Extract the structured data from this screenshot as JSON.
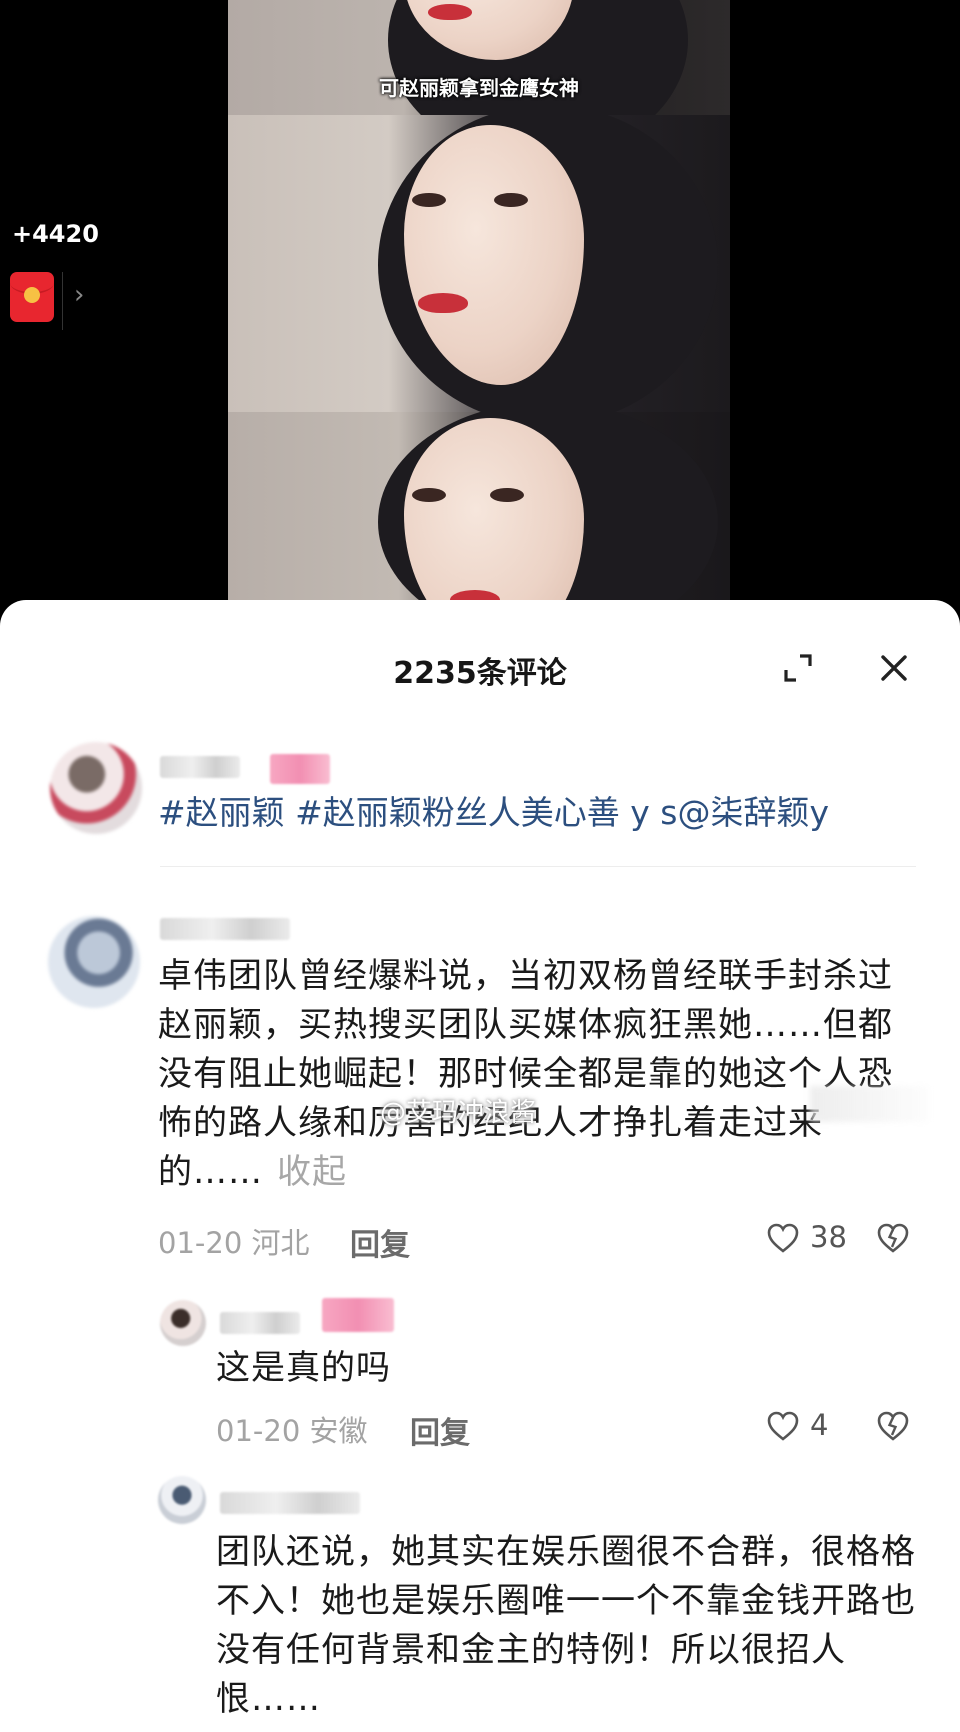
{
  "video": {
    "subtitle": "可赵丽颖拿到金鹰女神"
  },
  "overlay": {
    "counter": "+4420",
    "arrow": "›"
  },
  "sheet": {
    "title": "2235条评论",
    "comments": [
      {
        "text": "#赵丽颖 #赵丽颖粉丝人美心善 y s@柒辞颖y"
      },
      {
        "text": "卓伟团队曾经爆料说，当初双杨曾经联手封杀过赵丽颖，买热搜买团队买媒体疯狂黑她……但都没有阻止她崛起！那时候全都是靠的她这个人恐怖的路人缘和厉害的经纪人才挣扎着走过来的……",
        "collapse": "收起",
        "meta": "01-20 河北",
        "reply": "回复",
        "likes": "38"
      },
      {
        "text": "这是真的吗",
        "meta": "01-20 安徽",
        "reply": "回复",
        "likes": "4"
      },
      {
        "text": "团队还说，她其实在娱乐圈很不合群，很格格不入！她也是娱乐圈唯一一个不靠金钱开路也没有任何背景和金主的特例！所以很招人恨……"
      }
    ]
  },
  "watermark": "@艾玛冲浪酱"
}
